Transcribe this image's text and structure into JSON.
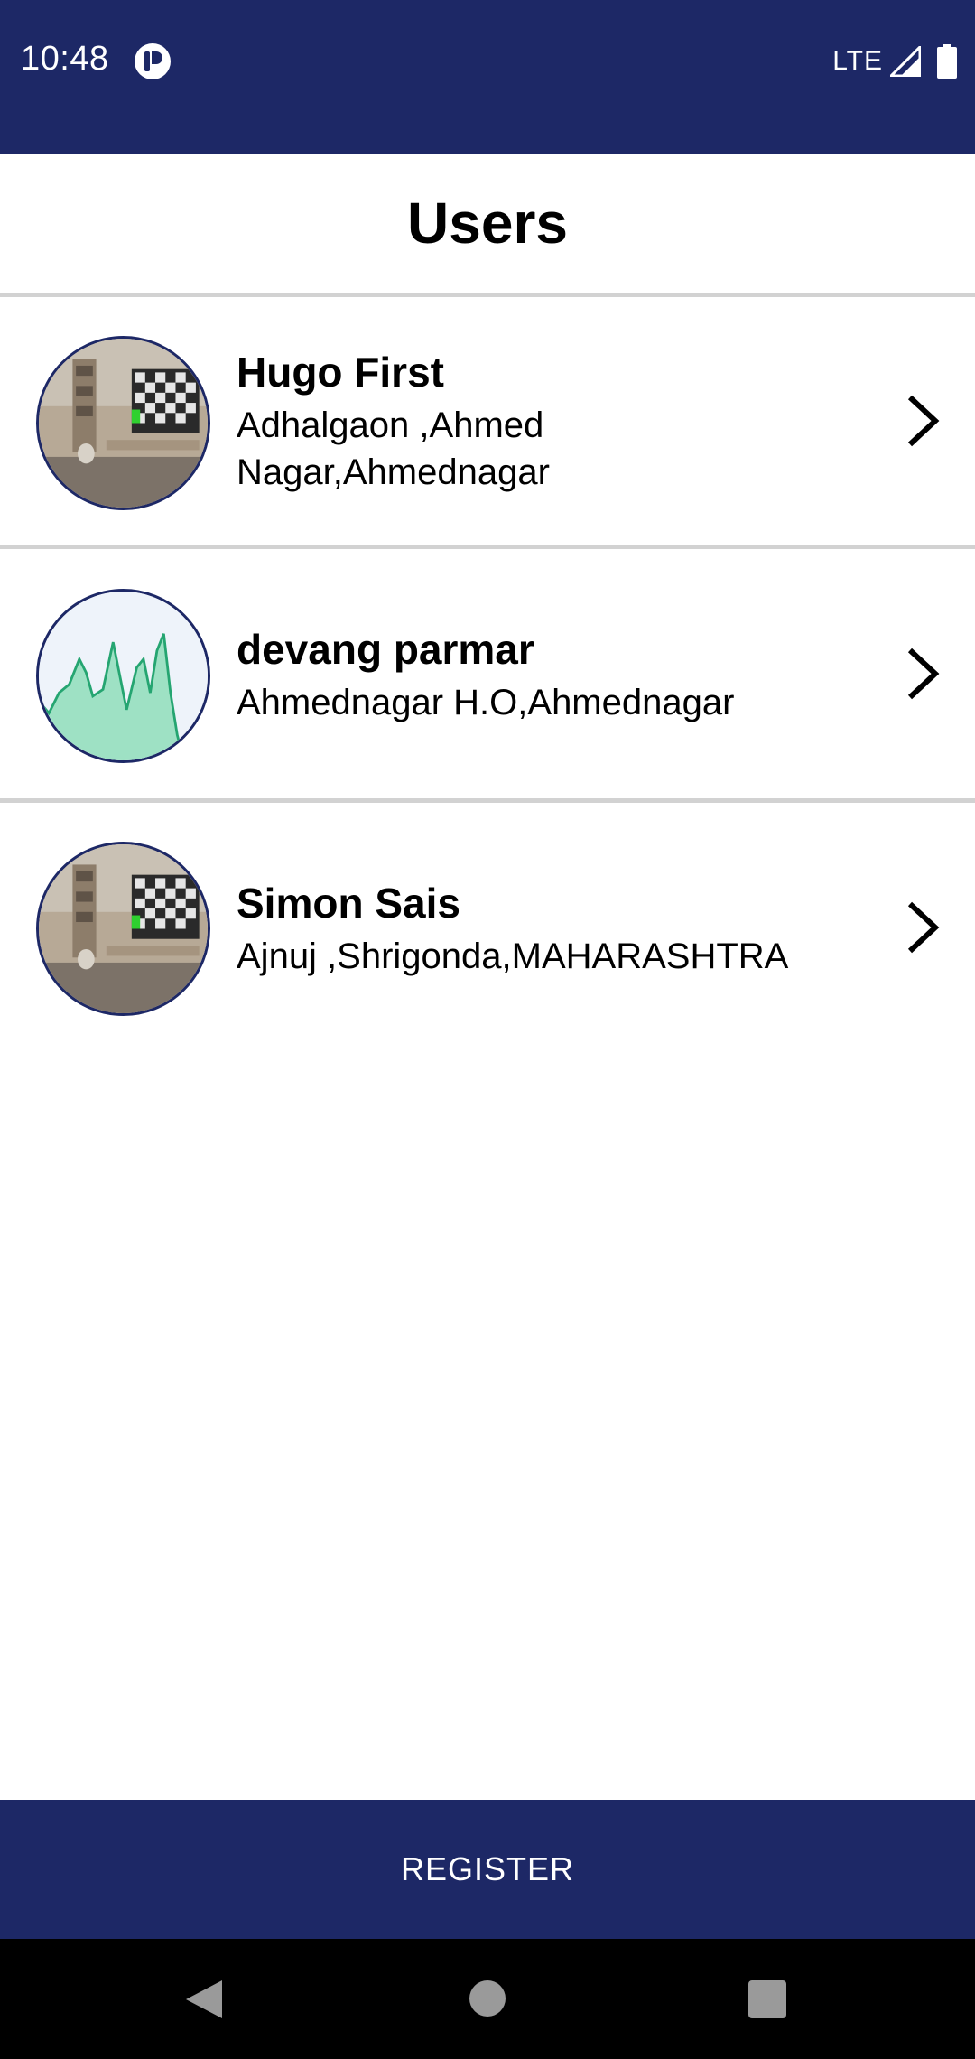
{
  "status_bar": {
    "time": "10:48",
    "network": "LTE",
    "icons": [
      "app-notification-icon",
      "signal-icon",
      "battery-icon"
    ]
  },
  "header": {
    "title": "Users"
  },
  "users": [
    {
      "name": "Hugo First",
      "address": "Adhalgaon ,Ahmed Nagar,Ahmednagar",
      "avatar": "room-photo"
    },
    {
      "name": "devang parmar",
      "address": "Ahmednagar H.O,Ahmednagar",
      "avatar": "waveform-chart"
    },
    {
      "name": "Simon Sais",
      "address": "Ajnuj ,Shrigonda,MAHARASHTRA",
      "avatar": "room-photo"
    }
  ],
  "footer": {
    "register_label": "REGISTER"
  },
  "colors": {
    "primary": "#1d2866",
    "divider": "#d2d2d2",
    "background": "#ffffff"
  },
  "nav": {
    "icons": [
      "back-icon",
      "home-icon",
      "recents-icon"
    ]
  }
}
